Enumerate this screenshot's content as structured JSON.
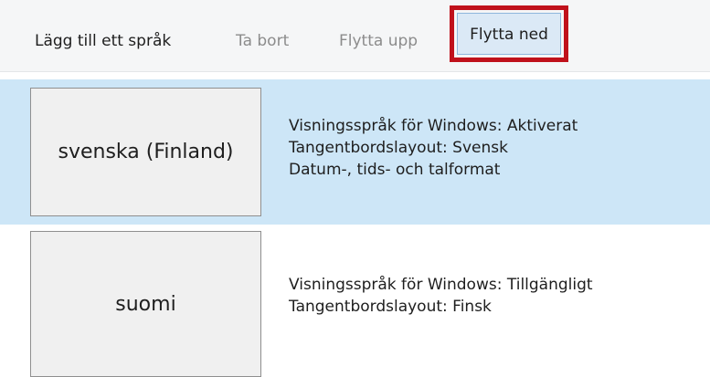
{
  "toolbar": {
    "add_language": "Lägg till ett språk",
    "remove": "Ta bort",
    "move_up": "Flytta upp",
    "move_down": "Flytta ned"
  },
  "languages": [
    {
      "name": "svenska (Finland)",
      "selected": true,
      "details": [
        "Visningsspråk för Windows: Aktiverat",
        "Tangentbordslayout: Svensk",
        "Datum-, tids- och talformat"
      ]
    },
    {
      "name": "suomi",
      "selected": false,
      "details": [
        "Visningsspråk för Windows: Tillgängligt",
        "Tangentbordslayout: Finsk"
      ]
    }
  ],
  "colors": {
    "selected_row": "#cde6f7",
    "highlight_frame": "#c0111b",
    "toolbar_bg": "#f5f6f7"
  }
}
